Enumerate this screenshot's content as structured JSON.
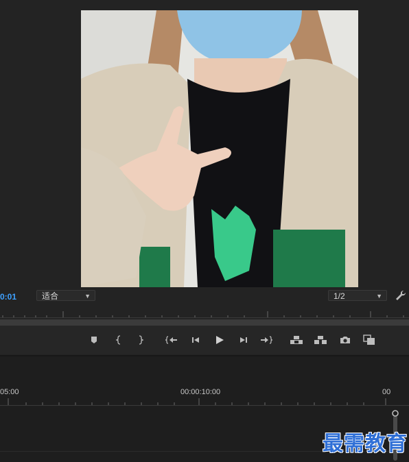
{
  "program_monitor": {
    "timecode": "0:01",
    "fit_select": "适合",
    "resolution_select": "1/2",
    "video_frame": "photo of a person in a blue face mask, cream hoodie with green lettering, making a peace sign"
  },
  "transport": {
    "buttons": [
      "add-marker",
      "mark-in",
      "mark-out",
      "go-to-in",
      "step-back",
      "play",
      "step-forward",
      "go-to-out",
      "lift",
      "extract",
      "export-frame",
      "comparison-view"
    ]
  },
  "timeline": {
    "labels": [
      "05:00",
      "00:00:10:00",
      "00"
    ]
  },
  "watermark": {
    "text": "最需教育"
  },
  "colors": {
    "timecode": "#3ea1ff",
    "panel": "#232323",
    "watermark": "#2f6fd6"
  }
}
